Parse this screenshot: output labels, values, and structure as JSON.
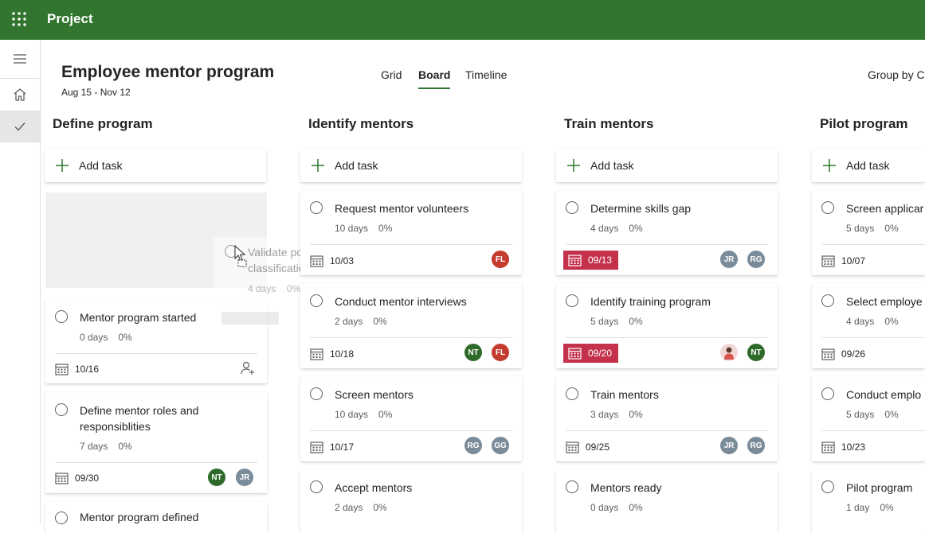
{
  "app": {
    "title": "Project"
  },
  "header": {
    "plan_title": "Employee mentor program",
    "dates": "Aug 15 - Nov 12",
    "tabs": [
      {
        "label": "Grid",
        "active": false
      },
      {
        "label": "Board",
        "active": true
      },
      {
        "label": "Timeline",
        "active": false
      }
    ],
    "group_by": "Group by C"
  },
  "colors": {
    "brand": "#31752f",
    "late": "#c4314b"
  },
  "add_task_label": "Add task",
  "buckets": [
    {
      "title": "Define program",
      "dragging_task": {
        "name": "Validate potential job classifications",
        "duration": "4 days",
        "percent": "0%"
      },
      "tasks": [
        {
          "name": "Mentor program started",
          "duration": "0 days",
          "percent": "0%",
          "due": "10/16",
          "assignees": []
        },
        {
          "name": "Define mentor roles and responsiblities",
          "duration": "7 days",
          "percent": "0%",
          "due": "09/30",
          "assignees": [
            "NT",
            "JR"
          ]
        },
        {
          "name": "Mentor program defined"
        }
      ]
    },
    {
      "title": "Identify mentors",
      "tasks": [
        {
          "name": "Request mentor volunteers",
          "duration": "10 days",
          "percent": "0%",
          "due": "10/03",
          "assignees": [
            "FL"
          ]
        },
        {
          "name": "Conduct mentor interviews",
          "duration": "2 days",
          "percent": "0%",
          "due": "10/18",
          "assignees": [
            "NT",
            "FL"
          ]
        },
        {
          "name": "Screen mentors",
          "duration": "10 days",
          "percent": "0%",
          "due": "10/17",
          "assignees": [
            "RG",
            "GG"
          ]
        },
        {
          "name": "Accept mentors",
          "duration": "2 days",
          "percent": "0%"
        }
      ]
    },
    {
      "title": "Train mentors",
      "tasks": [
        {
          "name": "Determine skills gap",
          "duration": "4 days",
          "percent": "0%",
          "due": "09/13",
          "late": true,
          "assignees": [
            "JR",
            "RG"
          ]
        },
        {
          "name": "Identify training program",
          "duration": "5 days",
          "percent": "0%",
          "due": "09/20",
          "late": true,
          "assignees": [
            "photo",
            "NT"
          ]
        },
        {
          "name": "Train mentors",
          "duration": "3 days",
          "percent": "0%",
          "due": "09/25",
          "assignees": [
            "JR",
            "RG"
          ]
        },
        {
          "name": "Mentors ready",
          "duration": "0 days",
          "percent": "0%"
        }
      ]
    },
    {
      "title": "Pilot program",
      "tasks": [
        {
          "name": "Screen applicar",
          "duration": "5 days",
          "percent": "0%",
          "due": "10/07"
        },
        {
          "name": "Select employe",
          "duration": "4 days",
          "percent": "0%",
          "due": "09/26"
        },
        {
          "name": "Conduct emplo",
          "duration": "5 days",
          "percent": "0%",
          "due": "10/23"
        },
        {
          "name": "Pilot program",
          "duration": "1 day",
          "percent": "0%"
        }
      ]
    }
  ]
}
